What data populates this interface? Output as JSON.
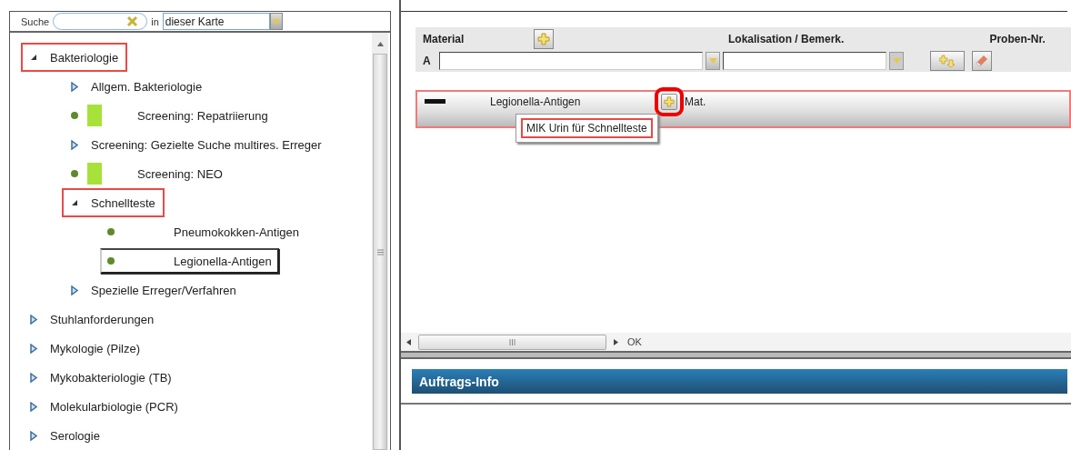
{
  "search": {
    "label": "Suche",
    "placeholder_scope_label": "in",
    "scope": "dieser Karte"
  },
  "tree": [
    {
      "label": "Bakteriologie",
      "kind": "folder",
      "expanded": true,
      "highlighted": true,
      "selected": false,
      "children": [
        {
          "label": "Allgem. Bakteriologie",
          "kind": "folder",
          "expanded": false,
          "highlighted": false,
          "selected": false
        },
        {
          "label": "Screening: Repatriierung",
          "kind": "leaf",
          "flagged": true,
          "highlighted": false,
          "selected": false
        },
        {
          "label": "Screening: Gezielte Suche multires. Erreger",
          "kind": "folder",
          "expanded": false,
          "highlighted": false,
          "selected": false
        },
        {
          "label": "Screening: NEO",
          "kind": "leaf",
          "flagged": true,
          "highlighted": false,
          "selected": false
        },
        {
          "label": "Schnellteste",
          "kind": "folder",
          "expanded": true,
          "highlighted": true,
          "selected": false,
          "children": [
            {
              "label": "Pneumokokken-Antigen",
              "kind": "leaf",
              "flagged": false,
              "highlighted": false,
              "selected": false
            },
            {
              "label": "Legionella-Antigen",
              "kind": "leaf",
              "flagged": false,
              "highlighted": false,
              "selected": true
            }
          ]
        },
        {
          "label": "Spezielle Erreger/Verfahren",
          "kind": "folder",
          "expanded": false,
          "highlighted": false,
          "selected": false
        }
      ]
    },
    {
      "label": "Stuhlanforderungen",
      "kind": "folder",
      "expanded": false,
      "highlighted": false,
      "selected": false
    },
    {
      "label": "Mykologie (Pilze)",
      "kind": "folder",
      "expanded": false,
      "highlighted": false,
      "selected": false
    },
    {
      "label": "Mykobakteriologie (TB)",
      "kind": "folder",
      "expanded": false,
      "highlighted": false,
      "selected": false
    },
    {
      "label": "Molekularbiologie (PCR)",
      "kind": "folder",
      "expanded": false,
      "highlighted": false,
      "selected": false
    },
    {
      "label": "Serologie",
      "kind": "folder",
      "expanded": false,
      "highlighted": false,
      "selected": false
    }
  ],
  "form": {
    "material_label": "Material",
    "location_label": "Lokalisation / Bemerk.",
    "sample_label": "Proben-Nr.",
    "row_label": "A"
  },
  "order_row": {
    "name": "Legionella-Antigen",
    "material_label": "Mat.",
    "highlighted": true,
    "add_circled": true,
    "popup": {
      "item": "MIK Urin für Schnellteste",
      "highlighted": true
    }
  },
  "status": "OK",
  "info_title": "Auftrags-Info"
}
